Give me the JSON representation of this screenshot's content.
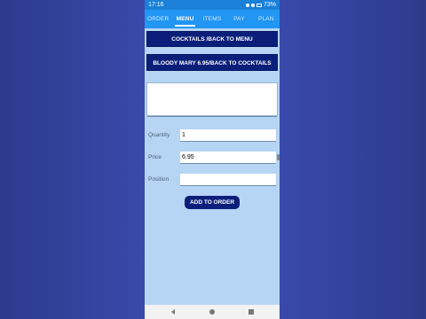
{
  "status_bar": {
    "time": "17:16",
    "battery": "73%"
  },
  "tabs": [
    {
      "label": "ORDER",
      "active": false
    },
    {
      "label": "MENU",
      "active": true
    },
    {
      "label": "ITEMS",
      "active": false
    },
    {
      "label": "PAY",
      "active": false
    },
    {
      "label": "PLAN",
      "active": false
    }
  ],
  "nav": {
    "back_to_menu_label": "COCKTAILS /BACK TO MENU",
    "back_to_cocktails_label": "BLOODY MARY 6.95/BACK TO COCKTAILS"
  },
  "form": {
    "notes_value": "",
    "quantity_label": "Quantity",
    "quantity_value": "1",
    "price_label": "Price",
    "price_value": "6.95",
    "position_label": "Position",
    "position_value": ""
  },
  "add_button_label": "ADD TO ORDER",
  "colors": {
    "background": "#3949ab",
    "tabbar": "#2196f3",
    "button": "#0b1f7a",
    "screen": "#b6d5f4"
  }
}
